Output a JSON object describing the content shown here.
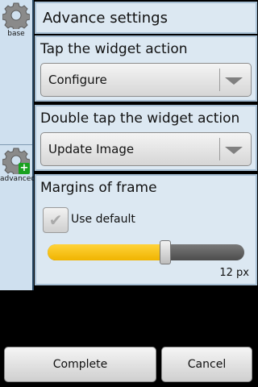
{
  "sidebar": {
    "tabs": [
      {
        "label": "base",
        "icon": "gear-icon"
      },
      {
        "label": "advanced",
        "icon": "gear-add-icon"
      }
    ]
  },
  "header": {
    "title": "Advance settings"
  },
  "tap_action": {
    "title": "Tap the widget action",
    "selected": "Configure"
  },
  "double_tap_action": {
    "title": "Double tap the widget action",
    "selected": "Update Image"
  },
  "margins": {
    "title": "Margins of frame",
    "use_default_label": "Use default",
    "use_default_checked": true,
    "slider_fraction": 0.6,
    "value_text": "12 px"
  },
  "buttons": {
    "complete": "Complete",
    "cancel": "Cancel"
  },
  "colors": {
    "accent": "#f5c20a",
    "panel": "#dce8f2",
    "sidebar": "#cfe0ef"
  }
}
